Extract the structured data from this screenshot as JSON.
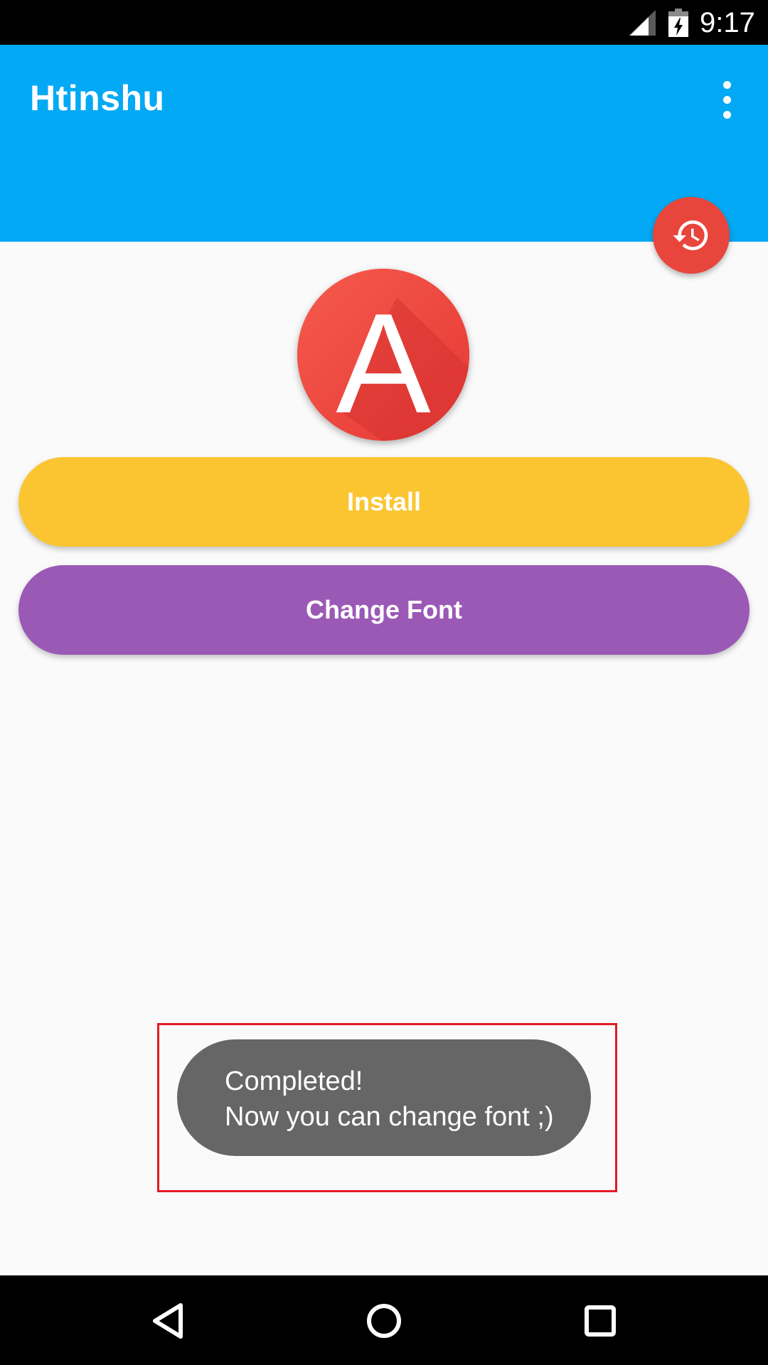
{
  "status_bar": {
    "time": "9:17",
    "icons": [
      "signal-icon",
      "battery-charging-icon"
    ]
  },
  "app_bar": {
    "title": "Htinshu",
    "menu_icon": "more-vert-icon",
    "color": "#03a9f4"
  },
  "fab": {
    "icon": "history-icon",
    "color": "#e8453c"
  },
  "logo": {
    "letter": "A",
    "color": "#f44336"
  },
  "buttons": {
    "install_label": "Install",
    "install_color": "#fbc532",
    "change_font_label": "Change Font",
    "change_font_color": "#9b59b6"
  },
  "toast": {
    "line1": "Completed!",
    "line2": "Now you can change font ;)",
    "highlight_color": "#e31b23"
  },
  "nav_bar": {
    "icons": [
      "back-icon",
      "home-icon",
      "recent-apps-icon"
    ]
  }
}
